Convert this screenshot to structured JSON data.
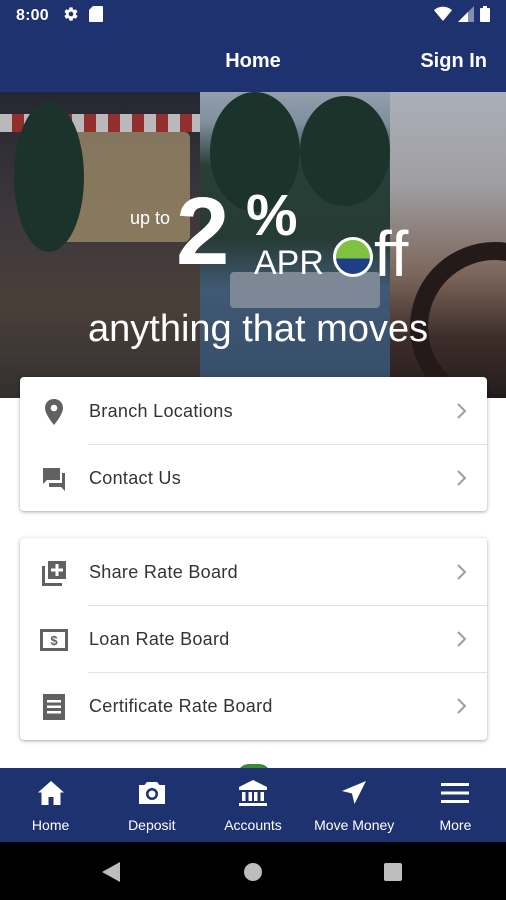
{
  "status_bar": {
    "time": "8:00",
    "left_icons": [
      "gear-icon",
      "sd-card-icon"
    ],
    "right_icons": [
      "wifi-icon",
      "signal-icon",
      "battery-icon"
    ]
  },
  "app_bar": {
    "title": "Home",
    "sign_in": "Sign In"
  },
  "hero": {
    "up_to": "up to",
    "rate_number": "2",
    "rate_percent": "%",
    "rate_apr": "APR",
    "off_suffix": "ff",
    "tagline": "anything that moves"
  },
  "cards": {
    "card_1": [
      {
        "label": "Branch Locations",
        "icon": "location-pin-icon"
      },
      {
        "label": "Contact Us",
        "icon": "chat-icon"
      }
    ],
    "card_2": [
      {
        "label": "Share Rate Board",
        "icon": "add-library-icon"
      },
      {
        "label": "Loan Rate Board",
        "icon": "dollar-bill-icon"
      },
      {
        "label": "Certificate Rate Board",
        "icon": "receipt-icon"
      }
    ]
  },
  "bottom_nav": [
    {
      "label": "Home",
      "icon": "home-icon"
    },
    {
      "label": "Deposit",
      "icon": "camera-icon"
    },
    {
      "label": "Accounts",
      "icon": "bank-icon"
    },
    {
      "label": "Move Money",
      "icon": "navigation-arrow-icon"
    },
    {
      "label": "More",
      "icon": "menu-icon"
    }
  ],
  "system_nav": [
    "back-icon",
    "home-circle-icon",
    "recents-icon"
  ],
  "colors": {
    "brand_navy": "#1f3270",
    "brand_green": "#7fc241",
    "text": "#333333",
    "icon_gray": "#616161"
  }
}
